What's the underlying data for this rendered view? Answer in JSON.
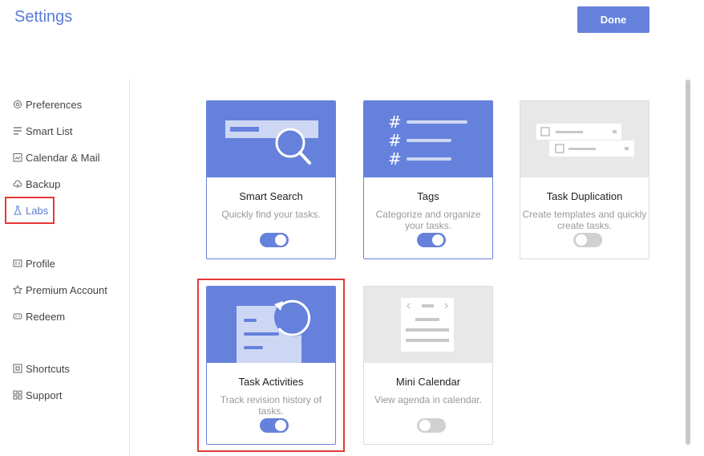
{
  "header": {
    "title": "Settings",
    "done_label": "Done"
  },
  "sidebar": {
    "items": [
      {
        "label": "Preferences",
        "icon": "gear-icon"
      },
      {
        "label": "Smart List",
        "icon": "list-icon"
      },
      {
        "label": "Calendar & Mail",
        "icon": "calendar-icon"
      },
      {
        "label": "Backup",
        "icon": "cloud-icon"
      },
      {
        "label": "Labs",
        "icon": "flask-icon",
        "active": true
      },
      {
        "label": "Profile",
        "icon": "id-card-icon"
      },
      {
        "label": "Premium Account",
        "icon": "badge-icon"
      },
      {
        "label": "Redeem",
        "icon": "ticket-icon"
      },
      {
        "label": "Shortcuts",
        "icon": "command-icon"
      },
      {
        "label": "Support",
        "icon": "grid-icon"
      }
    ]
  },
  "labs": {
    "cards": [
      {
        "name": "Smart Search",
        "description": "Quickly find your tasks.",
        "enabled": true
      },
      {
        "name": "Tags",
        "description": "Categorize and organize your tasks.",
        "enabled": true
      },
      {
        "name": "Task Duplication",
        "description": "Create templates and quickly create tasks.",
        "enabled": false
      },
      {
        "name": "Task Activities",
        "description": "Track revision history of tasks.",
        "enabled": true
      },
      {
        "name": "Mini Calendar",
        "description": "View agenda in calendar.",
        "enabled": false
      }
    ]
  },
  "colors": {
    "accent": "#6581db",
    "title": "#5b7bd5",
    "highlight": "#e53935",
    "disabled_banner": "#e8e8e8"
  }
}
